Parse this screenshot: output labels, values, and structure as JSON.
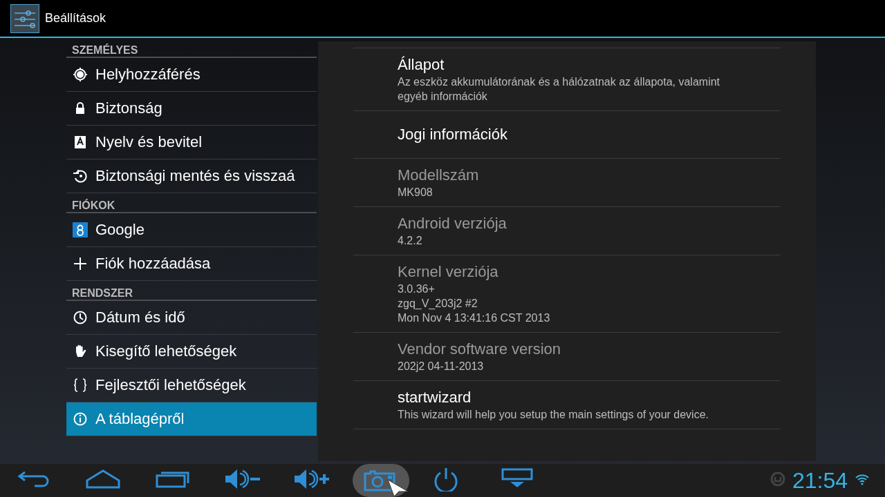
{
  "action_bar": {
    "title": "Beállítások"
  },
  "sidebar": {
    "sections": [
      {
        "header": "SZEMÉLYES",
        "items": [
          {
            "kind": "location",
            "label": "Helyhozzáférés",
            "selected": false
          },
          {
            "kind": "lock",
            "label": "Biztonság",
            "selected": false
          },
          {
            "kind": "language",
            "label": "Nyelv és bevitel",
            "selected": false
          },
          {
            "kind": "backup",
            "label": "Biztonsági mentés és visszaá",
            "selected": false
          }
        ]
      },
      {
        "header": "FIÓKOK",
        "items": [
          {
            "kind": "google",
            "label": "Google",
            "selected": false
          },
          {
            "kind": "plus",
            "label": "Fiók hozzáadása",
            "selected": false
          }
        ]
      },
      {
        "header": "RENDSZER",
        "items": [
          {
            "kind": "clock",
            "label": "Dátum és idő",
            "selected": false
          },
          {
            "kind": "hand",
            "label": "Kisegítő lehetőségek",
            "selected": false
          },
          {
            "kind": "braces",
            "label": "Fejlesztői lehetőségek",
            "selected": false
          },
          {
            "kind": "info",
            "label": "A táblagépről",
            "selected": true
          }
        ]
      }
    ]
  },
  "detail": {
    "items": [
      {
        "title": "Állapot",
        "disabled": false,
        "summary": [
          "Az eszköz akkumulátorának és a hálózatnak az állapota, valamint egyéb információk"
        ]
      },
      {
        "title": "Jogi információk",
        "disabled": false
      },
      {
        "title": "Modellszám",
        "disabled": true,
        "summary": [
          "MK908"
        ]
      },
      {
        "title": "Android verziója",
        "disabled": true,
        "summary": [
          "4.2.2"
        ]
      },
      {
        "title": "Kernel verziója",
        "disabled": true,
        "summary": [
          "3.0.36+",
          "zgq_V_203j2 #2",
          "Mon Nov 4 13:41:16 CST 2013"
        ]
      },
      {
        "title": "Vendor software version",
        "disabled": true,
        "summary": [
          "202j2 04-11-2013"
        ]
      },
      {
        "title": "startwizard",
        "disabled": false,
        "summary": [
          "This wizard will help you setup the main settings of your device."
        ]
      }
    ]
  },
  "nav_bar": {
    "buttons": [
      {
        "kind": "back",
        "pressed": false
      },
      {
        "kind": "home",
        "pressed": false
      },
      {
        "kind": "recent",
        "pressed": false
      },
      {
        "kind": "volume_down",
        "pressed": false
      },
      {
        "kind": "volume_up",
        "pressed": false
      },
      {
        "kind": "screenshot",
        "pressed": true
      },
      {
        "kind": "power",
        "pressed": false
      },
      {
        "kind": "hide",
        "pressed": false
      }
    ],
    "time": "21:54"
  }
}
